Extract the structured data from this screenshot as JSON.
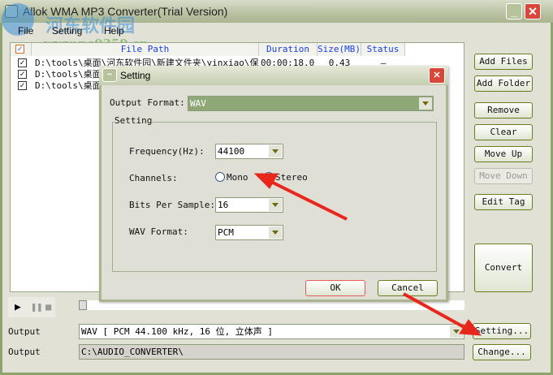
{
  "window": {
    "title": "Allok WMA MP3 Converter(Trial Version)",
    "minimize": "_",
    "close": "✕"
  },
  "watermark": {
    "brand": "河东软件园",
    "url": "www.pc0359.cn"
  },
  "menu": [
    "File",
    "Setting",
    "Help"
  ],
  "list": {
    "columns": [
      "File Path",
      "Duration",
      "Size(MB)",
      "Status"
    ],
    "rows": [
      {
        "path": "D:\\tools\\桌面\\河东软件园\\新建文件夹\\yinxiao\\保镖出来",
        "duration": "00:00:18.0",
        "size": "0.43",
        "status": "—"
      },
      {
        "path": "D:\\tools\\桌面",
        "duration": "",
        "size": "",
        "status": ""
      },
      {
        "path": "D:\\tools\\桌面",
        "duration": "",
        "size": "",
        "status": ""
      }
    ]
  },
  "side_buttons": [
    "Add Files",
    "Add Folder",
    "Remove",
    "Clear",
    "Move Up",
    "Move Down",
    "Edit Tag",
    "Convert"
  ],
  "dialog": {
    "title": "Setting",
    "output_format_label": "Output Format:",
    "output_format": "WAV",
    "group": "Setting",
    "frequency_label": "Frequency(Hz):",
    "frequency": "44100",
    "channels_label": "Channels:",
    "mono": "Mono",
    "stereo": "Stereo",
    "channel_selected": "Stereo",
    "bits_label": "Bits Per Sample:",
    "bits": "16",
    "wav_format_label": "WAV Format:",
    "wav_format": "PCM",
    "ok": "OK",
    "cancel": "Cancel"
  },
  "output": {
    "label1": "Output",
    "format": "WAV [ PCM 44.100 kHz, 16 位, 立体声 ]",
    "setting_button": "Setting...",
    "label2": "Output",
    "folder": "C:\\AUDIO_CONVERTER\\",
    "change_button": "Change..."
  },
  "colors": {
    "arrow": "#e8261c",
    "titlebar": "#a9b491",
    "header_text": "#1a3ee0"
  }
}
